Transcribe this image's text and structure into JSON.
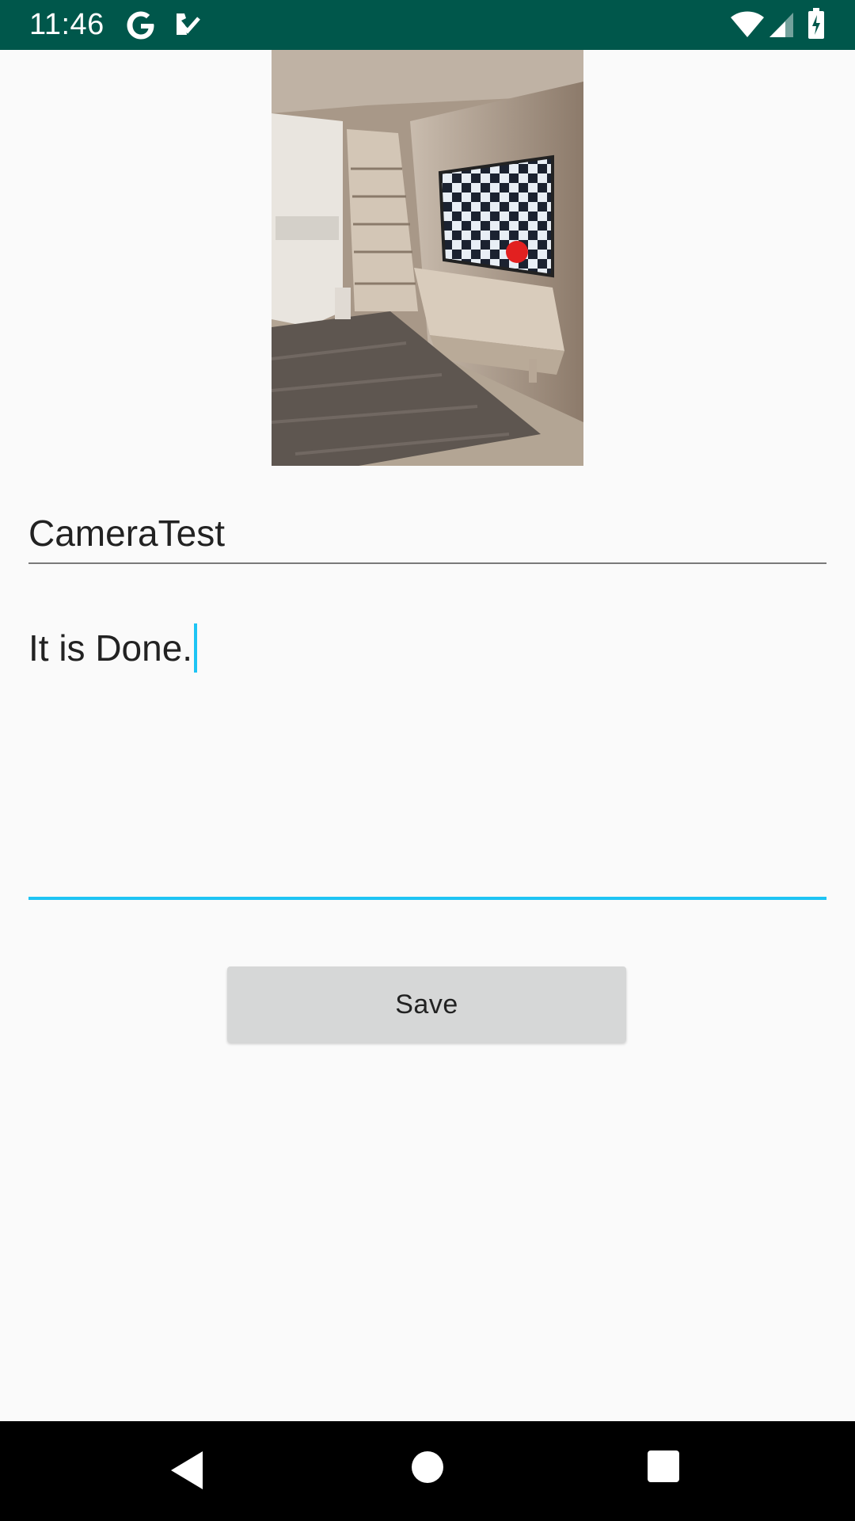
{
  "status_bar": {
    "time": "11:46",
    "background": "#00574b",
    "icons": [
      "google-icon",
      "task-check-icon",
      "wifi-icon",
      "signal-icon",
      "battery-icon"
    ]
  },
  "photo": {
    "description_icon": "room-photo"
  },
  "form": {
    "title_value": "CameraTest",
    "body_value": "It is Done.",
    "focus_color": "#1ec4f4",
    "save_label": "Save"
  },
  "nav_bar": {
    "icons": [
      "back-icon",
      "home-icon",
      "recents-icon"
    ]
  }
}
